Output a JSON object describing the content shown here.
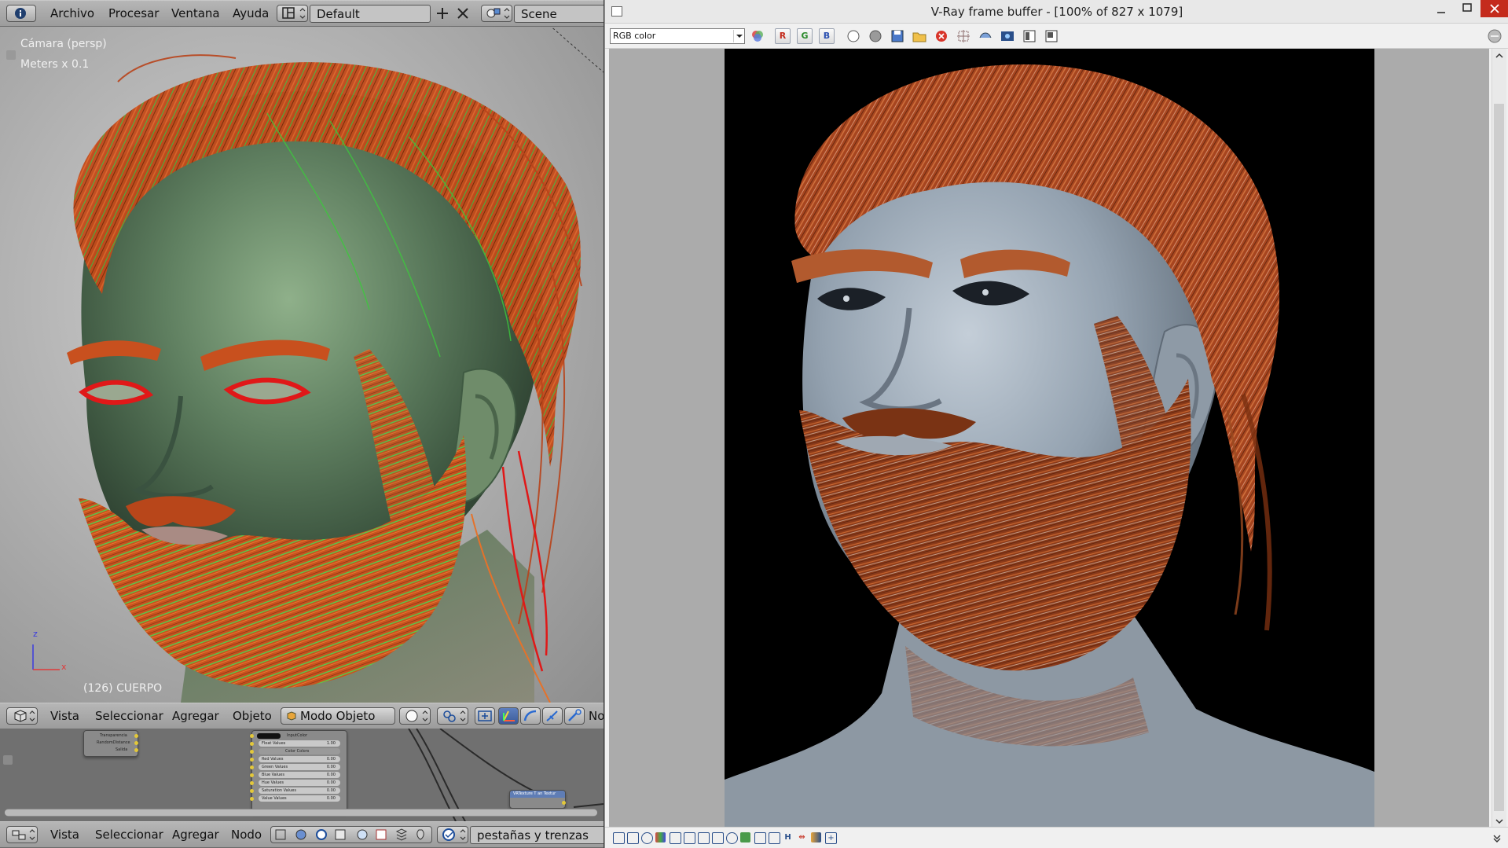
{
  "blender": {
    "top_header": {
      "menus": [
        "Archivo",
        "Procesar",
        "Ventana",
        "Ayuda"
      ],
      "layout_value": "Default",
      "scene_value": "Scene"
    },
    "viewport": {
      "camera_label": "Cámara (persp)",
      "units_label": "Meters x 0.1",
      "object_label": "(126) CUERPO",
      "axis_z": "z",
      "axis_x": "x"
    },
    "view3d_header": {
      "menus": [
        "Vista",
        "Seleccionar",
        "Agregar",
        "Objeto"
      ],
      "mode_value": "Modo Objeto",
      "truncated_text": "No"
    },
    "node_header": {
      "menus": [
        "Vista",
        "Seleccionar",
        "Agregar",
        "Nodo"
      ],
      "material_value": "pestañas y trenzas"
    },
    "nodes": {
      "left_node_rows": [
        "Transparencia",
        "RandomDistance",
        "Salida"
      ],
      "mid_node_rows": [
        "InputColor",
        "Float Values",
        "Color Colors",
        "Red Values",
        "Green Values",
        "Blue Values",
        "Hue Values",
        "Saturation Values",
        "Value Values"
      ],
      "mid_node_values": [
        "1.00",
        "0.00",
        "0.00",
        "0.00",
        "0.00",
        "0.00",
        "0.00"
      ],
      "right_node_label": "VRTexture T  an Textur"
    }
  },
  "vray": {
    "title": "V-Ray frame buffer - [100% of 827 x 1079]",
    "channel_value": "RGB color",
    "toolbar_icons": [
      "channel-color-icon",
      "red-channel-icon",
      "green-channel-icon",
      "blue-channel-icon",
      "white-circle-icon",
      "gray-circle-icon",
      "save-icon",
      "open-folder-icon",
      "clear-icon",
      "region-icon",
      "track-mouse-icon",
      "render-icon",
      "compare-icon",
      "history-icon"
    ],
    "toolbar_letters": {
      "r": "R",
      "g": "G",
      "b": "B"
    },
    "status_letter_h": "H"
  },
  "colors": {
    "blender_header": "#a8a8a8",
    "hair_orange": "#c8501e",
    "guide_green": "#3ccd3c",
    "vray_bg": "#f0f0f0",
    "close_red": "#c42b1c"
  }
}
